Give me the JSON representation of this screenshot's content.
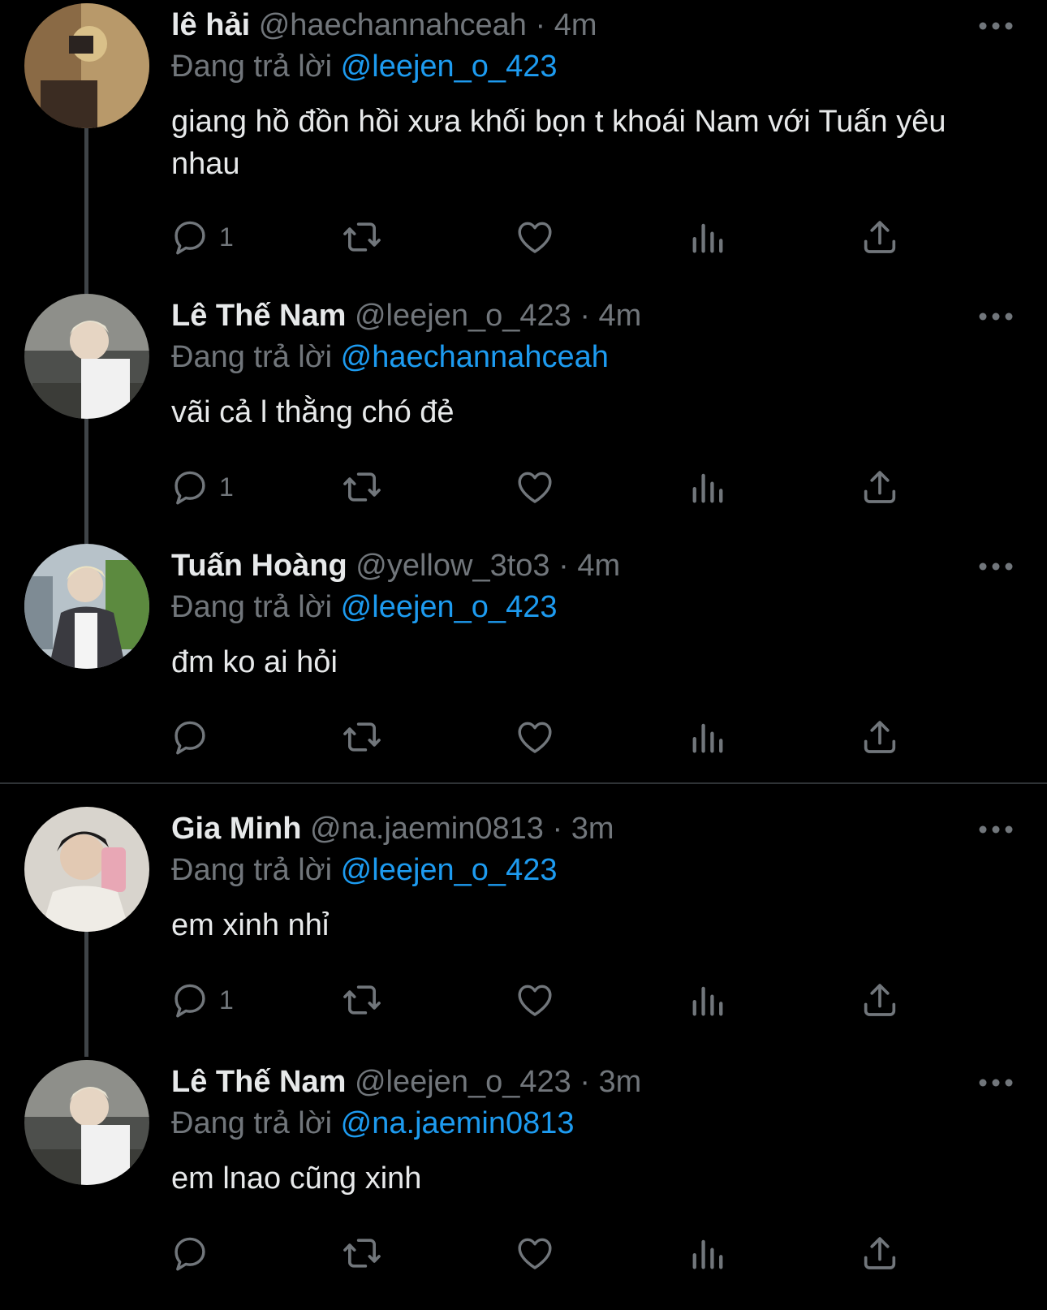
{
  "colors": {
    "background": "#000000",
    "text": "#e7e9ea",
    "muted": "#71767b",
    "link": "#1d9bf0",
    "thread_line": "#3f4448"
  },
  "replying_prefix": "Đang trả lời",
  "tweets": [
    {
      "name": "lê hải",
      "handle": "@haechannahceah",
      "time": "4m",
      "reply_to": "@leejen_o_423",
      "text": "giang hồ đồn hồi xưa khối bọn t khoái Nam với Tuấn yêu nhau",
      "reply_count": "1"
    },
    {
      "name": "Lê Thế Nam",
      "handle": "@leejen_o_423",
      "time": "4m",
      "reply_to": "@haechannahceah",
      "text": "vãi cả l thằng chó đẻ",
      "reply_count": "1"
    },
    {
      "name": "Tuấn Hoàng",
      "handle": "@yellow_3to3",
      "time": "4m",
      "reply_to": "@leejen_o_423",
      "text": "đm ko ai hỏi",
      "reply_count": ""
    },
    {
      "name": "Gia Minh",
      "handle": "@na.jaemin0813",
      "time": "3m",
      "reply_to": "@leejen_o_423",
      "text": "em xinh nhỉ",
      "reply_count": "1"
    },
    {
      "name": "Lê Thế Nam",
      "handle": "@leejen_o_423",
      "time": "3m",
      "reply_to": "@na.jaemin0813",
      "text": "em lnao cũng xinh",
      "reply_count": ""
    }
  ],
  "icons": [
    "reply-icon",
    "retweet-icon",
    "like-icon",
    "views-icon",
    "share-icon",
    "more-icon"
  ]
}
